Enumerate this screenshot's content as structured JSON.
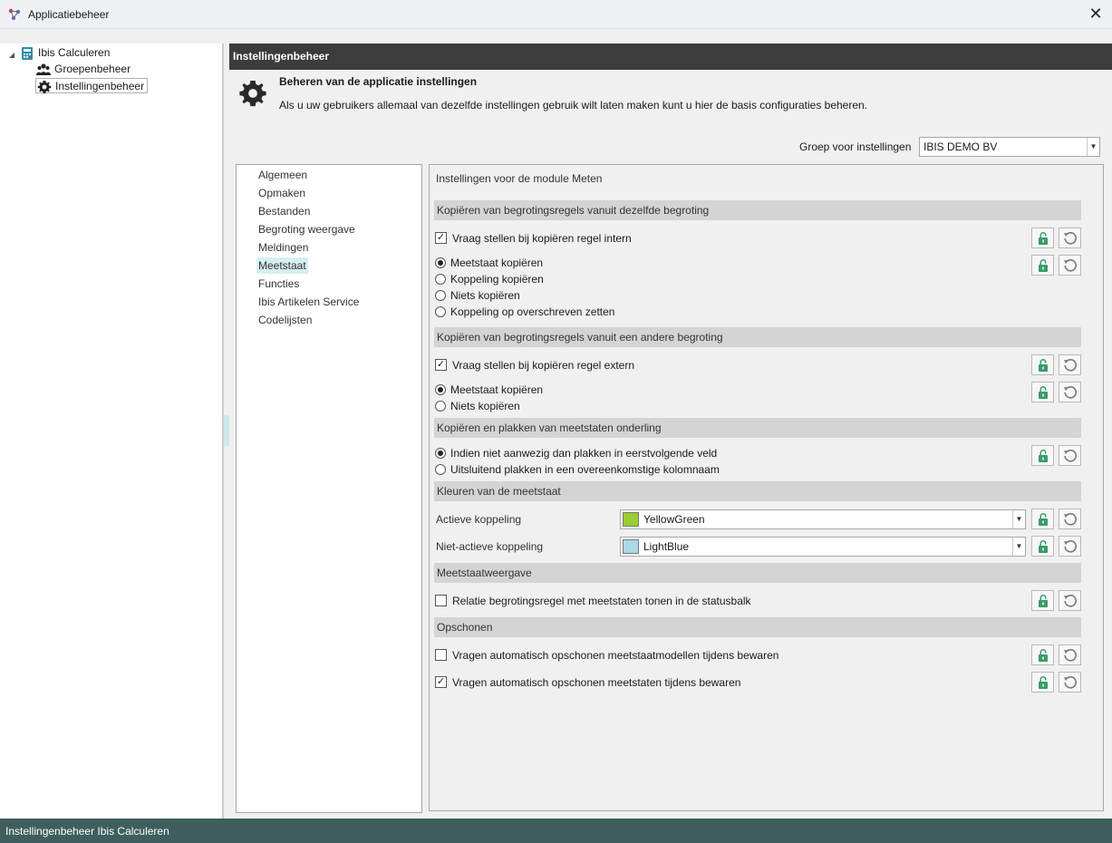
{
  "window": {
    "title": "Applicatiebeheer",
    "close_glyph": "✕"
  },
  "tree": {
    "root": {
      "label": "Ibis Calculeren",
      "icon": "calculator-icon"
    },
    "children": [
      {
        "label": "Groepenbeheer",
        "icon": "users-icon"
      },
      {
        "label": "Instellingenbeheer",
        "icon": "gear-icon",
        "selected": true
      }
    ]
  },
  "main": {
    "header": "Instellingenbeheer",
    "intro_title": "Beheren van de applicatie instellingen",
    "intro_desc": "Als u uw gebruikers allemaal van dezelfde instellingen gebruik wilt laten maken kunt u hier de basis configuraties beheren.",
    "group_label": "Groep voor instellingen",
    "group_value": "IBIS DEMO BV"
  },
  "nav": {
    "items": [
      "Algemeen",
      "Opmaken",
      "Bestanden",
      "Begroting weergave",
      "Meldingen",
      "Meetstaat",
      "Functies",
      "Ibis Artikelen Service",
      "Codelijsten"
    ],
    "active": "Meetstaat"
  },
  "content": {
    "title": "Instellingen voor de module Meten",
    "sections": {
      "s1": "Kopiëren van begrotingsregels vanuit dezelfde begroting",
      "s2": "Kopiëren van begrotingsregels vanuit een andere begroting",
      "s3": "Kopiëren en plakken van meetstaten onderling",
      "s4": "Kleuren van de meetstaat",
      "s5": "Meetstaatweergave",
      "s6": "Opschonen"
    },
    "s1_check": {
      "label": "Vraag stellen bij kopiëren regel intern",
      "checked": true
    },
    "s1_radios": [
      "Meetstaat kopiëren",
      "Koppeling kopiëren",
      "Niets kopiëren",
      "Koppeling op overschreven zetten"
    ],
    "s1_radio_selected": "Meetstaat kopiëren",
    "s2_check": {
      "label": "Vraag stellen bij kopiëren regel extern",
      "checked": true
    },
    "s2_radios": [
      "Meetstaat kopiëren",
      "Niets kopiëren"
    ],
    "s2_radio_selected": "Meetstaat kopiëren",
    "s3_radios": [
      "Indien niet aanwezig dan plakken in eerstvolgende veld",
      "Uitsluitend plakken in een overeenkomstige kolomnaam"
    ],
    "s3_radio_selected": "Indien niet aanwezig dan plakken in eerstvolgende veld",
    "colors": [
      {
        "label": "Actieve koppeling",
        "value": "YellowGreen",
        "swatch": "#9ACD32"
      },
      {
        "label": "Niet-actieve koppeling",
        "value": "LightBlue",
        "swatch": "#ADD8E6"
      }
    ],
    "s5_check": {
      "label": "Relatie begrotingsregel met meetstaten tonen in de statusbalk",
      "checked": false
    },
    "s6_checks": [
      {
        "label": "Vragen automatisch opschonen meetstaatmodellen tijdens bewaren",
        "checked": false
      },
      {
        "label": "Vragen automatisch opschonen meetstaten tijdens bewaren",
        "checked": true
      }
    ],
    "check_glyph": "✓"
  },
  "status": {
    "text": "Instellingenbeheer Ibis Calculeren"
  },
  "colors": {
    "header_bg": "#3c3c3c",
    "status_bg": "#3f5e5d",
    "lock_green": "#3a9a6a",
    "nav_active": "#d6f0f2"
  }
}
